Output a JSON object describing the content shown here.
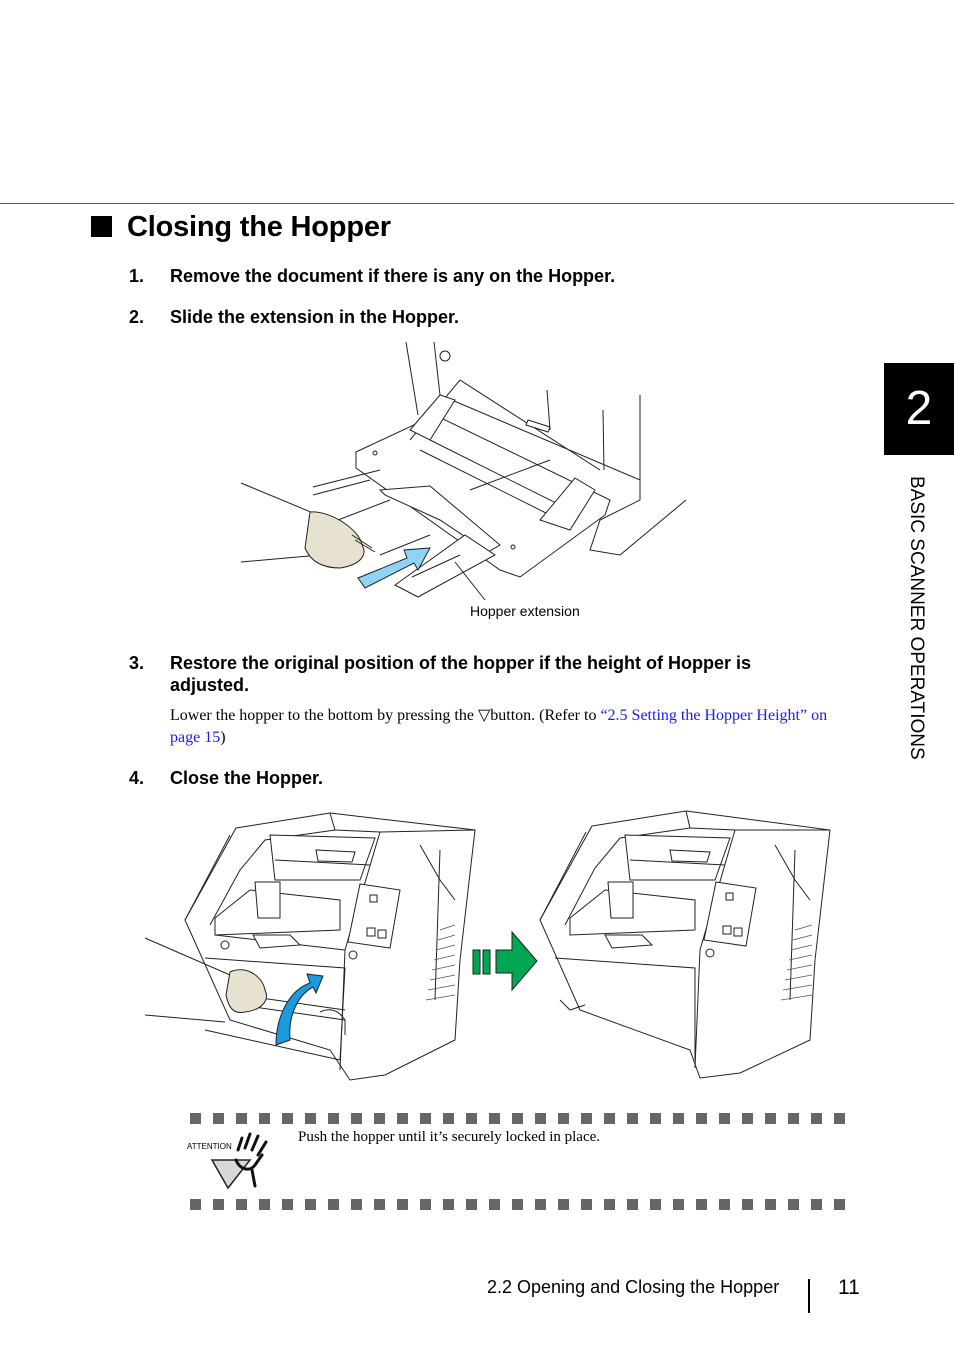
{
  "section": {
    "title": "Closing the Hopper",
    "bullet_icon": "black-square"
  },
  "steps": [
    {
      "number": "1.",
      "text": "Remove the document if there is any on the Hopper."
    },
    {
      "number": "2.",
      "text": "Slide the extension in the Hopper."
    },
    {
      "number": "3.",
      "text": "Restore the original position of the hopper if the height of Hopper is adjusted."
    },
    {
      "number": "4.",
      "text": " Close the Hopper."
    }
  ],
  "step3_detail": {
    "prefix": "Lower the hopper to the bottom by pressing the ",
    "button_glyph": "▽",
    "middle": "button. (Refer to ",
    "link_text": "“2.5 Setting the Hopper Height” on page 15",
    "suffix": ")"
  },
  "figure1": {
    "callout_label": "Hopper extension",
    "arrow_color": "#8fd3f5"
  },
  "figure2": {
    "transition_arrow_color": "#00a651",
    "curved_arrow_color": "#1a9be0"
  },
  "attention": {
    "icon_label": "ATTENTION",
    "text": "Push the hopper until it’s securely locked in place.",
    "dot_count": 29
  },
  "side_tab": {
    "chapter_number": "2",
    "chapter_title": "BASIC SCANNER OPERATIONS"
  },
  "footer": {
    "section_title": "2.2 Opening and Closing the Hopper",
    "page_number": "11"
  }
}
